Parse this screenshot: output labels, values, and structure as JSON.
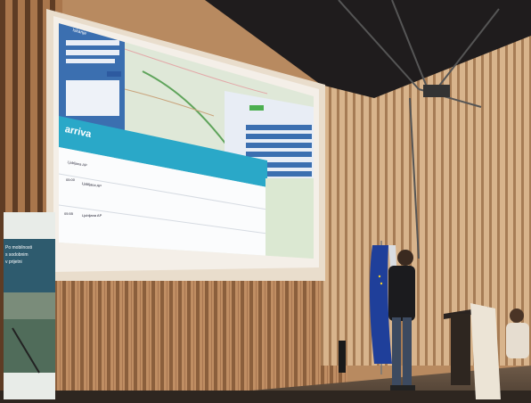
{
  "app": {
    "brand": "arriva"
  },
  "search_panel": {
    "title": "Iskanje"
  },
  "results": {
    "rows": [
      {
        "depart": "05:00",
        "place": "Ljubljana AP"
      },
      {
        "depart": "05:55",
        "place": "Ljubljana AP"
      }
    ],
    "from_label": "Ljubljana AP"
  },
  "banner": {
    "text_lines": [
      "Po mobilnosti",
      "s sodobnim",
      "v prijetni"
    ]
  },
  "colors": {
    "brand_teal": "#2aa8c8",
    "panel_blue": "#3b6fb0",
    "map_green": "#cfe3c0",
    "wood": "#c9a27a"
  }
}
